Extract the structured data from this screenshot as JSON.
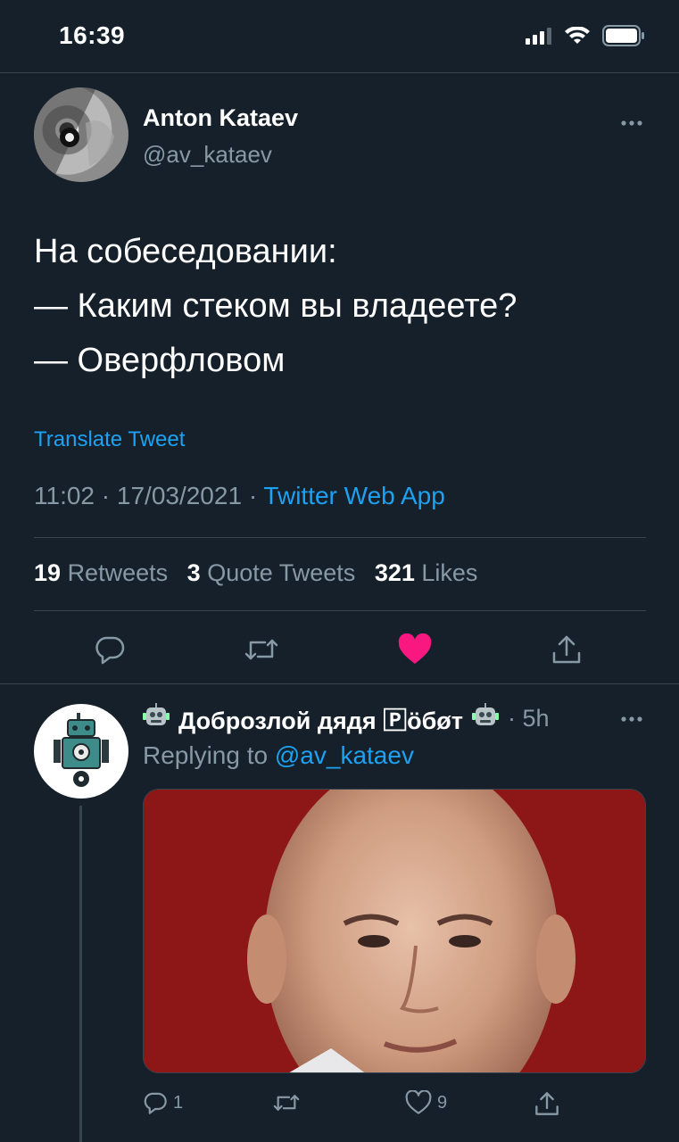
{
  "status_bar": {
    "time": "16:39"
  },
  "tweet": {
    "author_name": "Anton Kataev",
    "author_handle": "@av_kataev",
    "text_lines": [
      "На собеседовании:",
      "— Каким стеком вы владеете?",
      "— Оверфловом"
    ],
    "translate_label": "Translate Tweet",
    "time": "11:02",
    "date": "17/03/2021",
    "separator": "·",
    "source_app": "Twitter Web App",
    "stats": {
      "retweets_count": "19",
      "retweets_label": "Retweets",
      "quote_tweets_count": "3",
      "quote_tweets_label": "Quote Tweets",
      "likes_count": "321",
      "likes_label": "Likes"
    },
    "liked": true,
    "like_color": "#f91880",
    "accent_color": "#1da1f2"
  },
  "reply": {
    "author_name": "Доброзлой дядя 🄿öбøт",
    "time": "· 5h",
    "replying_prefix": "Replying to",
    "replying_to": "@av_kataev",
    "reply_count": "1",
    "like_count": "9"
  },
  "icons": [
    "signal-icon",
    "wifi-icon",
    "battery-icon",
    "more-icon",
    "reply-icon",
    "retweet-icon",
    "heart-icon",
    "share-icon",
    "robot-emoji-icon"
  ]
}
